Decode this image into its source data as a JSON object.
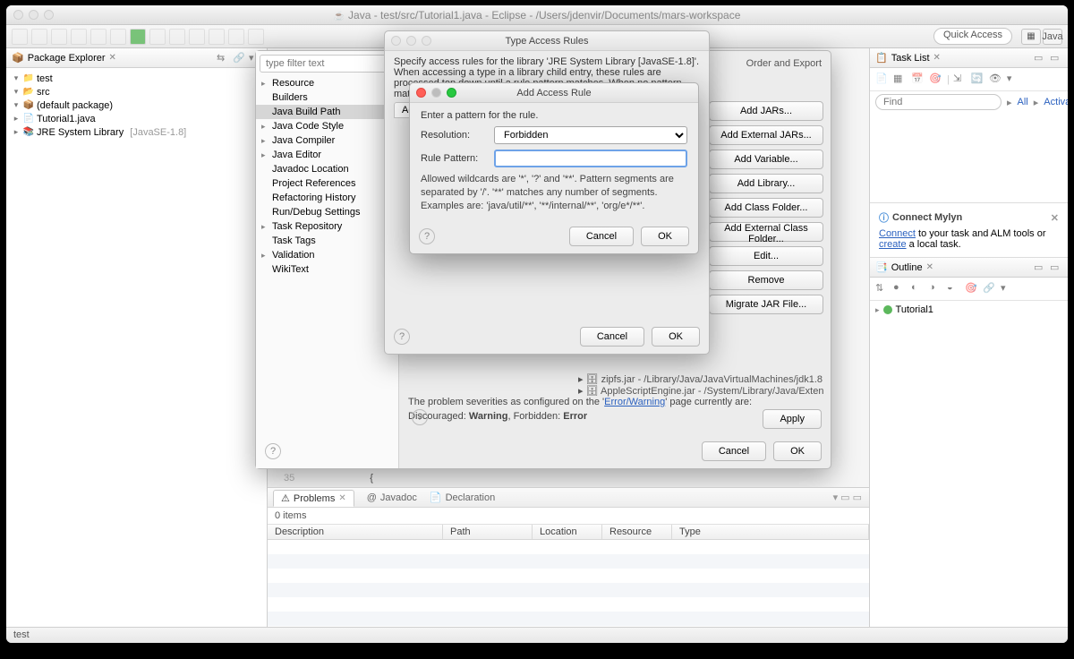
{
  "window": {
    "title": "Java - test/src/Tutorial1.java - Eclipse - /Users/jdenvir/Documents/mars-workspace"
  },
  "quick_access": "Quick Access",
  "perspective": {
    "label": "Java"
  },
  "package_explorer": {
    "title": "Package Explorer",
    "project": "test",
    "src": "src",
    "default_pkg": "(default package)",
    "file": "Tutorial1.java",
    "jre": "JRE System Library",
    "jre_env": "[JavaSE-1.8]"
  },
  "props": {
    "filter_placeholder": "type filter text",
    "categories": [
      "Resource",
      "Builders",
      "Java Build Path",
      "Java Code Style",
      "Java Compiler",
      "Java Editor",
      "Javadoc Location",
      "Project References",
      "Refactoring History",
      "Run/Debug Settings",
      "Task Repository",
      "Task Tags",
      "Validation",
      "WikiText"
    ],
    "selected": "Java Build Path",
    "tab_visible": "Order and Export",
    "side_buttons": [
      "Add JARs...",
      "Add External JARs...",
      "Add Variable...",
      "Add Library...",
      "Add Class Folder...",
      "Add External Class Folder...",
      "Edit...",
      "Remove",
      "Migrate JAR File..."
    ],
    "severity_line1": "The problem severities as configured on the '",
    "severity_link": "Error/Warning",
    "severity_line2": "' page currently are:",
    "severity_detail": "Discouraged: Warning, Forbidden: Error",
    "apply": "Apply",
    "cancel": "Cancel",
    "ok": "OK",
    "jar1": "zipfs.jar - /Library/Java/JavaVirtualMachines/jdk1.8",
    "jar2": "AppleScriptEngine.jar - /System/Library/Java/Exten"
  },
  "tar": {
    "title": "Type Access Rules",
    "desc": "Specify access rules for the library 'JRE System Library [JavaSE-1.8]'. When accessing a type in a library child entry, these rules are processed top down until a rule pattern matches. When no pattern matches, the rules defined for the library itself are processed.",
    "tab": "Access Rules",
    "cancel": "Cancel",
    "ok": "OK"
  },
  "aar": {
    "title": "Add Access Rule",
    "prompt": "Enter a pattern for the rule.",
    "resolution_label": "Resolution:",
    "resolution_value": "Forbidden",
    "pattern_label": "Rule Pattern:",
    "pattern_value": "",
    "help": "Allowed wildcards are '*', '?' and '**'. Pattern segments are separated by '/'. '**' matches any number of segments. Examples are: 'java/util/**', '**/internal/**', 'org/e*/**'.",
    "cancel": "Cancel",
    "ok": "OK"
  },
  "editor": {
    "line_no": "35",
    "brace": "{"
  },
  "problems": {
    "tab_problems": "Problems",
    "tab_javadoc": "Javadoc",
    "tab_declaration": "Declaration",
    "count": "0 items",
    "cols": [
      "Description",
      "Path",
      "Location",
      "Resource",
      "Type"
    ]
  },
  "task_list": {
    "title": "Task List",
    "find_placeholder": "Find",
    "all": "All",
    "activate": "Activate..."
  },
  "mylyn": {
    "title": "Connect Mylyn",
    "text1": "Connect",
    "text2": " to your task and ALM tools or ",
    "text3": "create",
    "text4": " a local task."
  },
  "outline": {
    "title": "Outline",
    "item": "Tutorial1"
  },
  "status": "test"
}
